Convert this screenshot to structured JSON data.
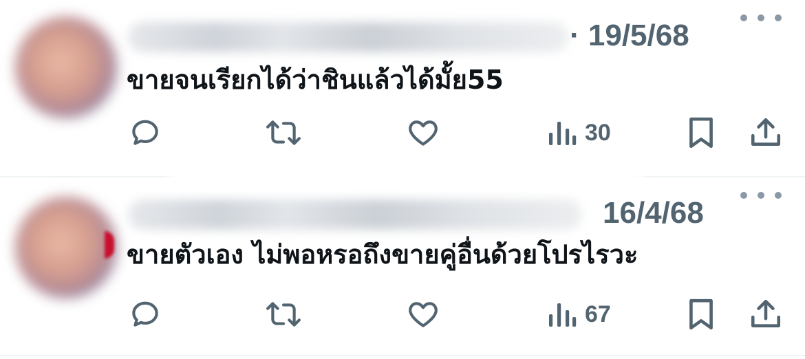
{
  "tweets": [
    {
      "date": "· 19/5/68",
      "text": "ขายจนเรียกได้ว่าชินแล้วได้มั้ย55",
      "views": "30"
    },
    {
      "date": "16/4/68",
      "text": "ขายตัวเอง ไม่พอหรอถึงขายคู่อื่นด้วยโปรไรวะ",
      "views": "67"
    }
  ],
  "icons": {
    "reply": "reply-icon",
    "retweet": "retweet-icon",
    "like": "heart-icon",
    "views": "views-icon",
    "bookmark": "bookmark-icon",
    "share": "share-icon",
    "more": "more-icon"
  },
  "colors": {
    "icon": "#536471",
    "text": "#0f1419",
    "divider": "#eff3f4"
  }
}
